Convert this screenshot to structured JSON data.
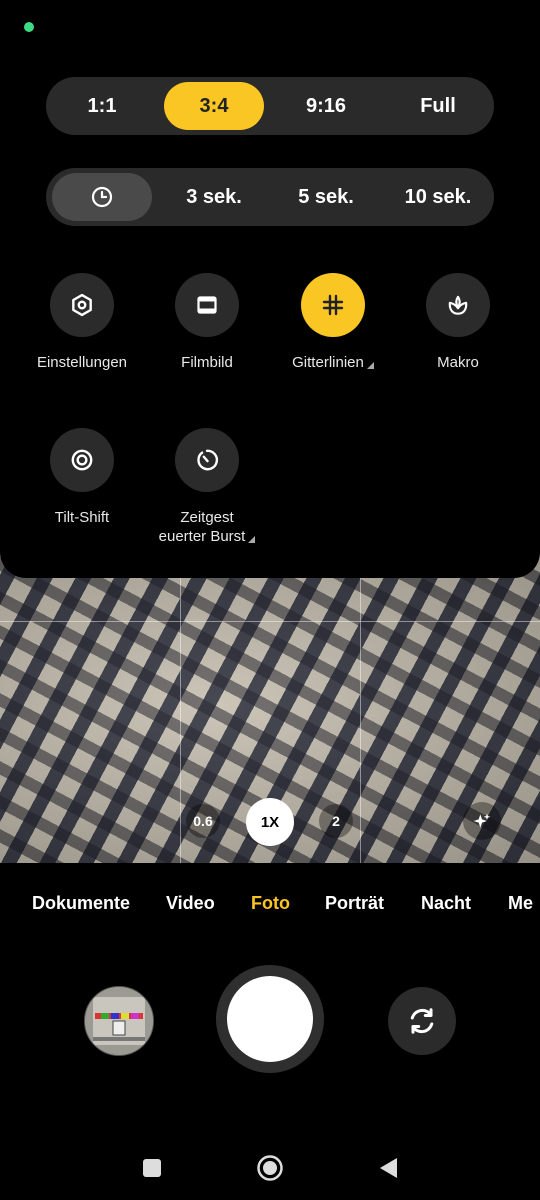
{
  "aspect_ratio": {
    "options": [
      "1:1",
      "3:4",
      "9:16",
      "Full"
    ],
    "selected": "3:4"
  },
  "timer": {
    "icon": "clock-icon",
    "options": [
      "3 sek.",
      "5 sek.",
      "10 sek."
    ]
  },
  "tiles": [
    {
      "label": "Einstellungen",
      "icon": "settings-icon",
      "active": false
    },
    {
      "label": "Filmbild",
      "icon": "film-frame-icon",
      "active": false
    },
    {
      "label": "Gitterlinien",
      "icon": "grid-icon",
      "active": true
    },
    {
      "label": "Makro",
      "icon": "macro-flower-icon",
      "active": false
    },
    {
      "label": "Tilt-Shift",
      "icon": "tilt-shift-icon",
      "active": false
    },
    {
      "label_line1": "Zeitgest",
      "label_line2": "euerter Burst",
      "icon": "timed-burst-icon",
      "active": false
    }
  ],
  "zoom": {
    "options": [
      "0.6",
      "1X",
      "2"
    ],
    "selected": "1X"
  },
  "modes": {
    "items": [
      "Dokumente",
      "Video",
      "Foto",
      "Porträt",
      "Nacht",
      "Me"
    ],
    "selected": "Foto"
  },
  "colors": {
    "accent": "#f9c623",
    "status_dot": "#3ddc84"
  }
}
